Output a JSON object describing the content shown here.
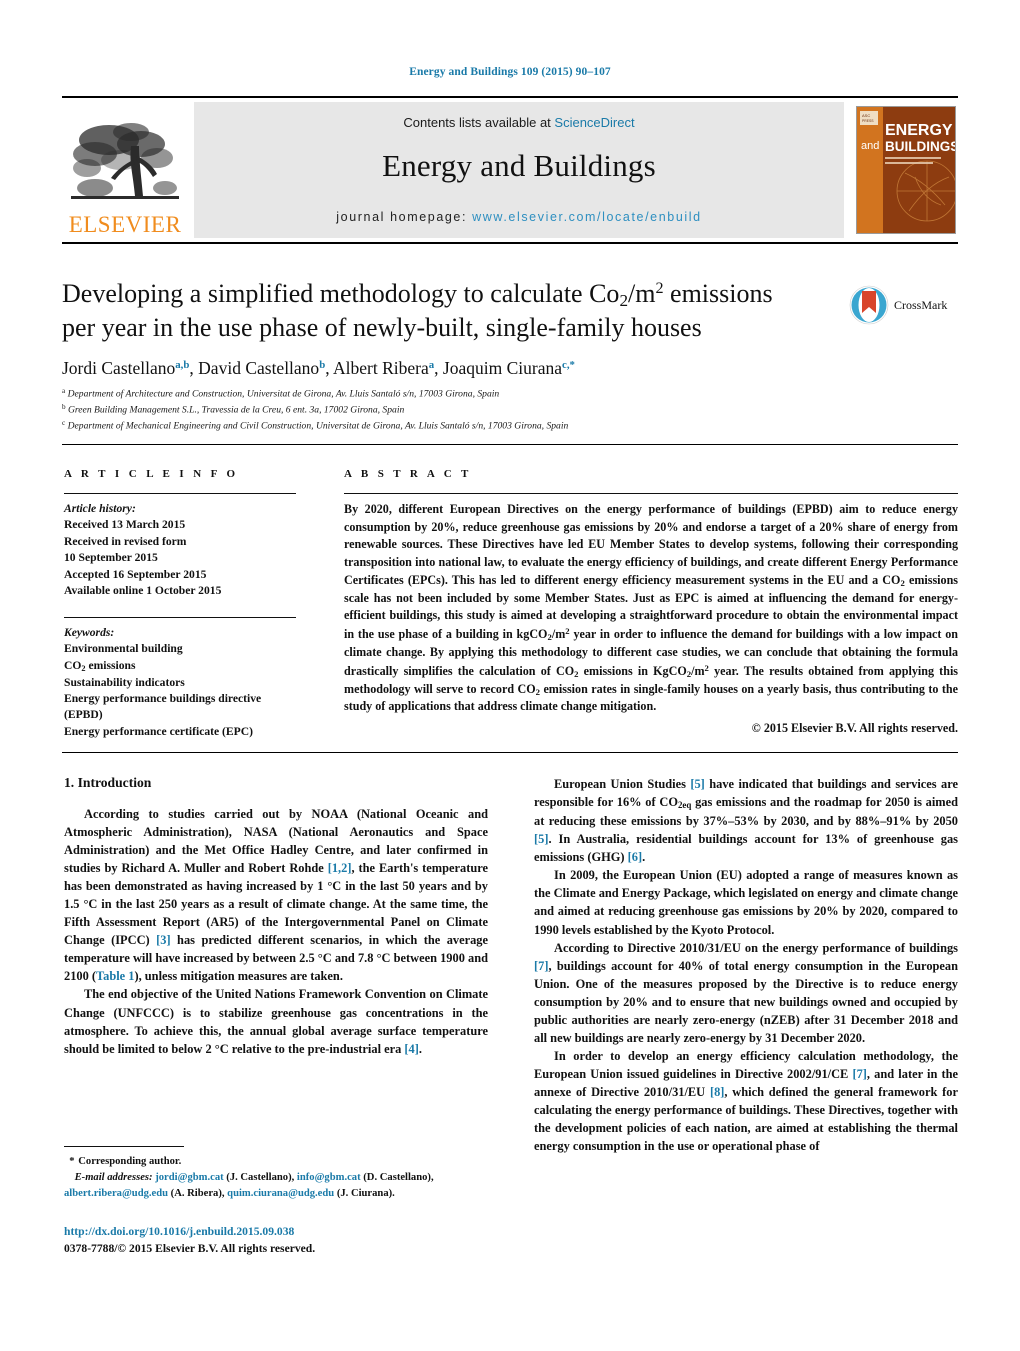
{
  "running_head": "Energy and Buildings 109 (2015) 90–107",
  "masthead": {
    "contents_prefix": "Contents lists available at ",
    "sciencedirect": "ScienceDirect",
    "journal_title": "Energy and Buildings",
    "homepage_label": "journal homepage:",
    "homepage_url": "www.elsevier.com/locate/enbuild",
    "publisher": "ELSEVIER",
    "cover": {
      "line_small": "and",
      "line1": "ENERGY",
      "line2": "BUILDINGS"
    }
  },
  "article": {
    "title_line1_a": "Developing a simplified methodology to calculate Co",
    "title_line1_sub": "2",
    "title_line1_b": "/m",
    "title_line1_sup": "2",
    "title_line1_c": " emissions",
    "title_line2": "per year in the use phase of newly-built, single-family houses",
    "crossmark_label": "CrossMark",
    "authors": [
      {
        "name": "Jordi Castellano",
        "marks": "a,b",
        "sep": ", "
      },
      {
        "name": "David Castellano",
        "marks": "b",
        "sep": ", "
      },
      {
        "name": "Albert Ribera",
        "marks": "a",
        "sep": ", "
      },
      {
        "name": "Joaquim Ciurana",
        "marks": "c,*",
        "sep": ""
      }
    ],
    "affiliations": [
      {
        "mark": "a",
        "text": "Department of Architecture and Construction, Universitat de Girona, Av. Lluis Santaló s/n, 17003 Girona, Spain"
      },
      {
        "mark": "b",
        "text": "Green Building Management S.L., Travessia de la Creu, 6 ent. 3a, 17002 Girona, Spain"
      },
      {
        "mark": "c",
        "text": "Department of Mechanical Engineering and Civil Construction, Universitat de Girona, Av. Lluis Santaló s/n, 17003 Girona, Spain"
      }
    ]
  },
  "article_info": {
    "heading": "A R T I C L E    I N F O",
    "history_label": "Article history:",
    "history": [
      "Received 13 March 2015",
      "Received in revised form",
      "10 September 2015",
      "Accepted 16 September 2015",
      "Available online 1 October 2015"
    ],
    "keywords_label": "Keywords:",
    "keywords": [
      "Environmental building",
      "CO2 emissions",
      "Sustainability indicators",
      "Energy performance buildings directive",
      "(EPBD)",
      "Energy performance certificate (EPC)"
    ]
  },
  "abstract": {
    "heading": "A B S T R A C T",
    "paragraph_1": "By 2020, different European Directives on the energy performance of buildings (EPBD) aim to reduce energy consumption by 20%, reduce greenhouse gas emissions by 20% and endorse a target of a 20% share of energy from renewable sources. These Directives have led EU Member States to develop systems, following their corresponding transposition into national law, to evaluate the energy efficiency of buildings, and create different Energy Performance Certificates (EPCs). This has led to different energy efficiency measurement systems in the EU and a CO",
    "sub_1": "2",
    "paragraph_2": " emissions scale has not been included by some Member States. Just as EPC is aimed at influencing the demand for energy-efficient buildings, this study is aimed at developing a straightforward procedure to obtain the environmental impact in the use phase of a building in kgCO",
    "sub_2": "2",
    "paragraph_3": "/m",
    "sup_1": "2",
    "paragraph_4": " year in order to influence the demand for buildings with a low impact on climate change. By applying this methodology to different case studies, we can conclude that obtaining the formula drastically simplifies the calculation of CO",
    "sub_3": "2",
    "paragraph_5": " emissions in KgCO",
    "sub_4": "2",
    "paragraph_6": "/m",
    "sup_2": "2",
    "paragraph_7": " year. The results obtained from applying this methodology will serve to record CO",
    "sub_5": "2",
    "paragraph_8": " emission rates in single-family houses on a yearly basis, thus contributing to the study of applications that address climate change mitigation.",
    "copyright": "© 2015 Elsevier B.V. All rights reserved."
  },
  "introduction": {
    "section_title": "1.  Introduction",
    "left": {
      "p1_a": "According to studies carried out by NOAA (National Oceanic and Atmospheric Administration), NASA (National Aeronautics and Space Administration) and the Met Office Hadley Centre, and later confirmed in studies by Richard A. Muller and Robert Rohde ",
      "p1_ref1": "[1,2]",
      "p1_b": ", the Earth's temperature has been demonstrated as having increased by 1 °C in the last 50 years and by 1.5 °C in the last 250 years as a result of climate change. At the same time, the Fifth Assessment Report (AR5) of the Intergovernmental Panel on Climate Change (IPCC) ",
      "p1_ref2": "[3]",
      "p1_c": " has predicted different scenarios, in which the average temperature will have increased by between 2.5 °C and 7.8 °C between 1900 and 2100 (",
      "p1_tableref": "Table 1",
      "p1_d": "), unless mitigation measures are taken.",
      "p2_a": "The end objective of the United Nations Framework Convention on Climate Change (UNFCCC) is to stabilize greenhouse gas concentrations in the atmosphere. To achieve this, the annual global average surface temperature should be limited to below 2 °C relative to the pre-industrial era ",
      "p2_ref": "[4]",
      "p2_b": "."
    },
    "right": {
      "p1_a": "European Union Studies ",
      "p1_ref1": "[5]",
      "p1_b": " have indicated that buildings and services are responsible for 16% of CO",
      "p1_sub": "2eq",
      "p1_c": " gas emissions and the roadmap for 2050 is aimed at reducing these emissions by 37%–53% by 2030, and by 88%–91% by 2050 ",
      "p1_ref2": "[5]",
      "p1_d": ". In Australia, residential buildings account for 13% of greenhouse gas emissions (GHG) ",
      "p1_ref3": "[6]",
      "p1_e": ".",
      "p2": "In 2009, the European Union (EU) adopted a range of measures known as the Climate and Energy Package, which legislated on energy and climate change and aimed at reducing greenhouse gas emissions by 20% by 2020, compared to 1990 levels established by the Kyoto Protocol.",
      "p3_a": "According to Directive 2010/31/EU on the energy performance of buildings ",
      "p3_ref": "[7]",
      "p3_b": ", buildings account for 40% of total energy consumption in the European Union. One of the measures proposed by the Directive is to reduce energy consumption by 20% and to ensure that new buildings owned and occupied by public authorities are nearly zero-energy (nZEB) after 31 December 2018 and all new buildings are nearly zero-energy by 31 December 2020.",
      "p4_a": "In order to develop an energy efficiency calculation methodology, the European Union issued guidelines in Directive 2002/91/CE ",
      "p4_ref1": "[7]",
      "p4_b": ", and later in the annexe of Directive 2010/31/EU ",
      "p4_ref2": "[8]",
      "p4_c": ", which defined the general framework for calculating the energy performance of buildings. These Directives, together with the development policies of each nation, are aimed at establishing the thermal energy consumption in the use or operational phase of"
    }
  },
  "footnote": {
    "corresponding": "Corresponding author.",
    "email_label": "E-mail addresses:",
    "emails": [
      {
        "address": "jordi@gbm.cat",
        "person": " (J. Castellano), "
      },
      {
        "address": "info@gbm.cat",
        "person": " (D. Castellano), "
      },
      {
        "address": "albert.ribera@udg.edu",
        "person": " (A. Ribera), "
      },
      {
        "address": "quim.ciurana@udg.edu",
        "person": " (J. Ciurana)."
      }
    ],
    "doi": "http://dx.doi.org/10.1016/j.enbuild.2015.09.038",
    "issn": "0378-7788/© 2015 Elsevier B.V. All rights reserved."
  },
  "colors": {
    "link": "#1a7aa8",
    "elsevier_orange": "#f08c1e",
    "cover_orange": "#c25e18",
    "crossmark_blue": "#3aa6d0",
    "crossmark_red": "#d8452b"
  }
}
